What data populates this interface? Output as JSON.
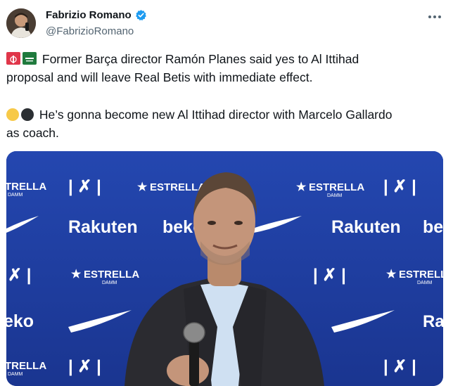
{
  "author": {
    "display_name": "Fabrizio Romano",
    "handle": "@FabrizioRomano",
    "verified": true
  },
  "icons": {
    "avatar": "avatar-photo",
    "verified": "verified-badge-icon",
    "more": "more-options-icon",
    "flag_1": "red-flag-emoji",
    "flag_2": "saudi-flag-emoji",
    "circle_1": "yellow-circle-emoji",
    "circle_2": "black-circle-emoji"
  },
  "tweet": {
    "line1": "Former Barça director Ramón Planes said yes to Al Ittihad",
    "line2": "proposal and will leave Real Betis with immediate effect.",
    "line3": "He’s gonna become new Al Ittihad director with Marcelo Gallardo",
    "line4": "as coach."
  },
  "media": {
    "backdrop_texts": {
      "estrella": "ESTRELLA",
      "damm": "DAMM",
      "rakuten": "Rakuten",
      "beko": "beko",
      "trella": "TRELLA",
      "eko": "eko",
      "ra": "Ra"
    }
  },
  "colors": {
    "accent": "#1d9bf0",
    "backdrop_blue": "#1d3d9a",
    "text": "#0f1419",
    "secondary_text": "#536471"
  }
}
